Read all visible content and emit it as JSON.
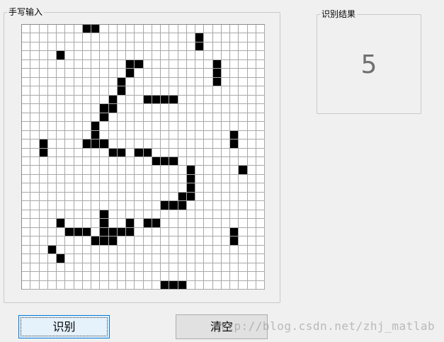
{
  "handwriting_panel": {
    "title": "手写输入",
    "grid": {
      "rows": 30,
      "cols": 28,
      "filled_cells": [
        [
          0,
          7
        ],
        [
          0,
          8
        ],
        [
          1,
          20
        ],
        [
          2,
          20
        ],
        [
          3,
          4
        ],
        [
          4,
          12
        ],
        [
          4,
          13
        ],
        [
          4,
          22
        ],
        [
          5,
          12
        ],
        [
          5,
          22
        ],
        [
          6,
          11
        ],
        [
          6,
          22
        ],
        [
          7,
          11
        ],
        [
          8,
          10
        ],
        [
          8,
          14
        ],
        [
          8,
          15
        ],
        [
          8,
          16
        ],
        [
          8,
          17
        ],
        [
          9,
          9
        ],
        [
          9,
          10
        ],
        [
          10,
          9
        ],
        [
          11,
          8
        ],
        [
          12,
          8
        ],
        [
          12,
          24
        ],
        [
          13,
          2
        ],
        [
          13,
          7
        ],
        [
          13,
          8
        ],
        [
          13,
          9
        ],
        [
          13,
          24
        ],
        [
          14,
          2
        ],
        [
          14,
          10
        ],
        [
          14,
          11
        ],
        [
          14,
          13
        ],
        [
          14,
          14
        ],
        [
          15,
          15
        ],
        [
          15,
          16
        ],
        [
          15,
          17
        ],
        [
          16,
          19
        ],
        [
          16,
          25
        ],
        [
          17,
          19
        ],
        [
          18,
          19
        ],
        [
          19,
          18
        ],
        [
          19,
          19
        ],
        [
          20,
          16
        ],
        [
          20,
          17
        ],
        [
          20,
          18
        ],
        [
          21,
          9
        ],
        [
          22,
          4
        ],
        [
          22,
          9
        ],
        [
          22,
          12
        ],
        [
          22,
          14
        ],
        [
          22,
          15
        ],
        [
          23,
          5
        ],
        [
          23,
          6
        ],
        [
          23,
          7
        ],
        [
          23,
          9
        ],
        [
          23,
          10
        ],
        [
          23,
          11
        ],
        [
          23,
          12
        ],
        [
          23,
          24
        ],
        [
          24,
          8
        ],
        [
          24,
          9
        ],
        [
          24,
          10
        ],
        [
          24,
          24
        ],
        [
          25,
          3
        ],
        [
          26,
          4
        ],
        [
          29,
          16
        ],
        [
          29,
          17
        ],
        [
          29,
          18
        ]
      ]
    }
  },
  "result_panel": {
    "title": "识别结果",
    "value": "5"
  },
  "buttons": {
    "recognize": "识别",
    "clear": "清空"
  },
  "watermark": "http://blog.csdn.net/zhj_matlab"
}
